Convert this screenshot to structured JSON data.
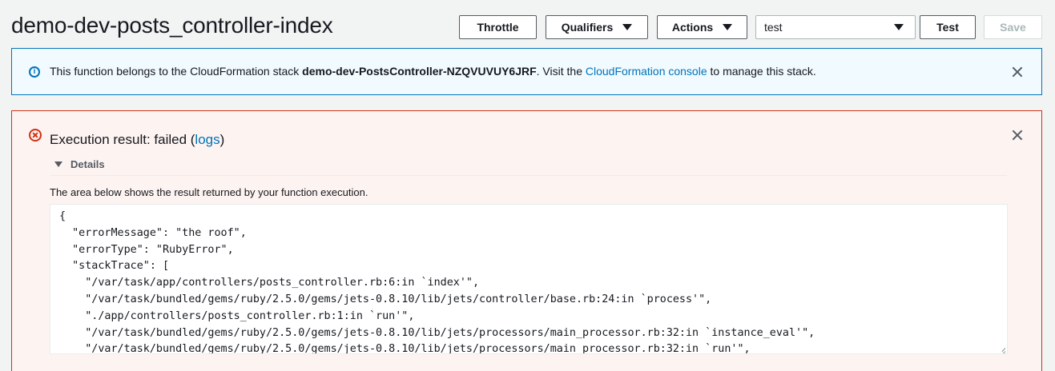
{
  "page_title": "demo-dev-posts_controller-index",
  "toolbar": {
    "throttle_label": "Throttle",
    "qualifiers_label": "Qualifiers",
    "actions_label": "Actions",
    "test_event_selected": "test",
    "test_label": "Test",
    "save_label": "Save"
  },
  "info_banner": {
    "icon": "info-icon",
    "text_before": "This function belongs to the CloudFormation stack ",
    "stack_name": "demo-dev-PostsController-NZQVUVUY6JRF",
    "text_middle": ". Visit the ",
    "link_text": "CloudFormation console",
    "text_after": " to manage this stack."
  },
  "execution_result": {
    "icon": "error-circle-icon",
    "title_prefix": "Execution result: failed (",
    "logs_link": "logs",
    "title_suffix": ")",
    "details_label": "Details",
    "description": "The area below shows the result returned by your function execution.",
    "result_lines": [
      "{",
      "  \"errorMessage\": \"the roof\",",
      "  \"errorType\": \"RubyError\",",
      "  \"stackTrace\": [",
      "    \"/var/task/app/controllers/posts_controller.rb:6:in `index'\",",
      "    \"/var/task/bundled/gems/ruby/2.5.0/gems/jets-0.8.10/lib/jets/controller/base.rb:24:in `process'\",",
      "    \"./app/controllers/posts_controller.rb:1:in `run'\",",
      "    \"/var/task/bundled/gems/ruby/2.5.0/gems/jets-0.8.10/lib/jets/processors/main_processor.rb:32:in `instance_eval'\",",
      "    \"/var/task/bundled/gems/ruby/2.5.0/gems/jets-0.8.10/lib/jets/processors/main_processor.rb:32:in `run'\","
    ]
  },
  "colors": {
    "info_border": "#0073bb",
    "info_bg": "#f1faff",
    "error_border": "#d13212",
    "error_bg": "#fdf3f1",
    "link": "#0073bb"
  }
}
